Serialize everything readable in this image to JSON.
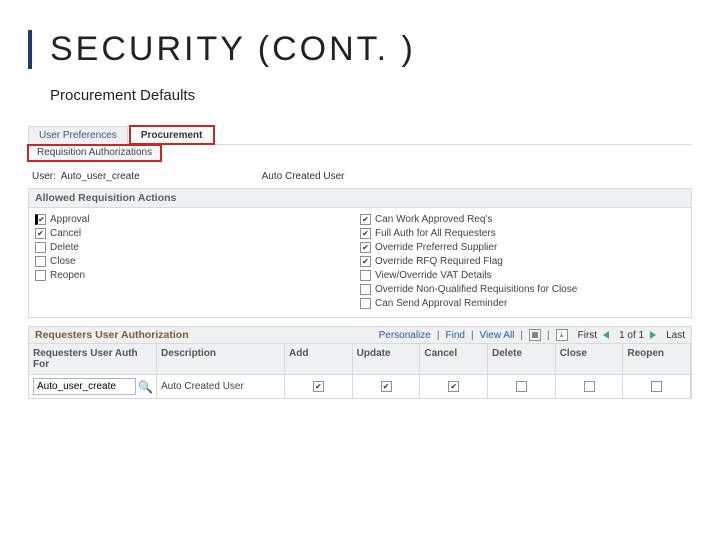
{
  "title": "SECURITY (CONT. )",
  "subtitle": "Procurement Defaults",
  "tabs": {
    "user_prefs": "User Preferences",
    "procurement": "Procurement"
  },
  "subtab": "Requisition Authorizations",
  "user": {
    "label": "User:",
    "value": "Auto_user_create",
    "auto_label": "Auto Created User"
  },
  "allowed_hdr": "Allowed Requisition Actions",
  "left_actions": {
    "approval": "Approval",
    "cancel": "Cancel",
    "delete": "Delete",
    "close": "Close",
    "reopen": "Reopen"
  },
  "right_actions": {
    "can_work": "Can Work Approved Req's",
    "full_auth": "Full Auth for All Requesters",
    "override_supplier": "Override Preferred Supplier",
    "override_rfq": "Override RFQ Required Flag",
    "view_vat": "View/Override VAT Details",
    "override_nonq": "Override Non-Qualified Requisitions for Close",
    "can_send": "Can Send Approval Reminder"
  },
  "auth": {
    "title": "Requesters User Authorization",
    "personalize": "Personalize",
    "find": "Find",
    "viewall": "View All",
    "first": "First",
    "range": "1 of 1",
    "last": "Last"
  },
  "grid": {
    "headers": {
      "c1": "Requesters User Auth For",
      "c2": "Description",
      "c3": "Add",
      "c4": "Update",
      "c5": "Cancel",
      "c6": "Delete",
      "c7": "Close",
      "c8": "Reopen"
    },
    "row": {
      "user": "Auto_user_create",
      "desc": "Auto Created User"
    }
  }
}
